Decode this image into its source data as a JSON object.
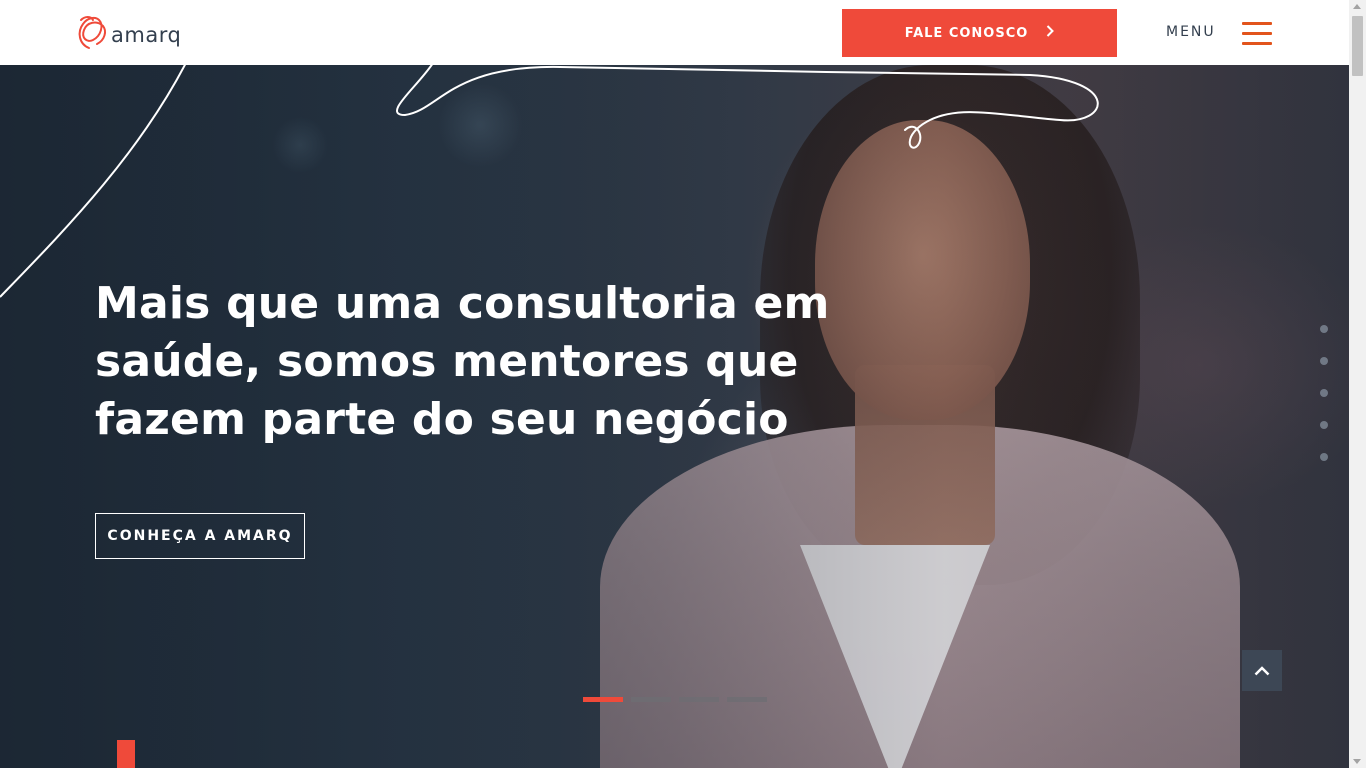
{
  "header": {
    "logo_text": "amarq",
    "cta_label": "FALE CONOSCO",
    "menu_label": "MENU"
  },
  "hero": {
    "headline": "Mais que uma consultoria em saúde, somos mentores que fazem parte do seu negócio",
    "button_label": "CONHEÇA A AMARQ",
    "slides_total": 4,
    "active_slide": 1,
    "section_dots_total": 5
  },
  "icons": {
    "logo": "amarq-logo-icon",
    "cta_arrow": "chevron-right-icon",
    "menu": "hamburger-menu-icon",
    "back_to_top": "chevron-up-icon"
  },
  "colors": {
    "accent": "#ef4a3a",
    "menu_icon": "#e2541c",
    "text_dark": "#333f4e",
    "hero_text": "#ffffff",
    "back_to_top_bg": "#3d4755"
  }
}
